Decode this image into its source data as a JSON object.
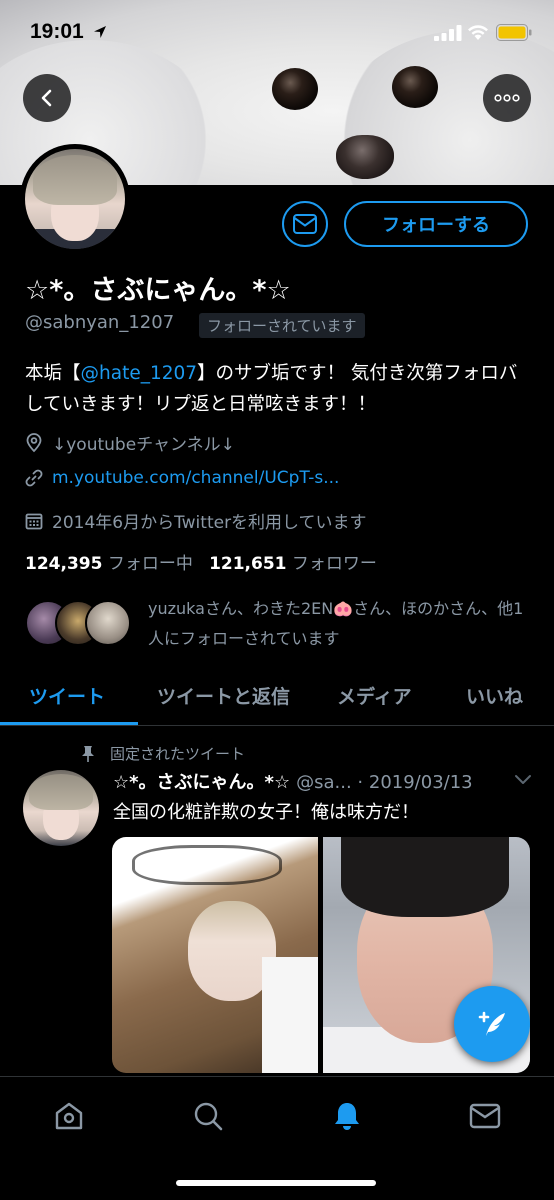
{
  "status_bar": {
    "time": "19:01"
  },
  "profile": {
    "display_name": "☆*。さぶにゃん。*☆",
    "handle": "@sabnyan_1207",
    "follows_you_badge": "フォローされています",
    "follow_button": "フォローする",
    "bio_before": "本垢【",
    "bio_mention": "@hate_1207",
    "bio_after": "】のサブ垢です！ 気付き次第フォロバしていきます！リプ返と日常呟きます！！",
    "location": "↓youtubeチャンネル↓",
    "link": "m.youtube.com/channel/UCpT-s...",
    "joined": "2014年6月からTwitterを利用しています",
    "following_count": "124,395",
    "following_label": "フォロー中",
    "followers_count": "121,651",
    "followers_label": "フォロワー",
    "followed_by_text": "yuzukaさん、わきた2EN🐽さん、ほのかさん、他1人にフォローされています"
  },
  "tabs": [
    {
      "label": "ツイート",
      "active": true
    },
    {
      "label": "ツイートと返信",
      "active": false
    },
    {
      "label": "メディア",
      "active": false
    },
    {
      "label": "いいね",
      "active": false
    }
  ],
  "pinned_tweet": {
    "pinned_label": "固定されたツイート",
    "name": "☆*。さぶにゃん。*☆",
    "handle": "@sa...",
    "date": "· 2019/03/13",
    "text": "全国の化粧詐欺の女子！俺は味方だ！"
  },
  "colors": {
    "accent": "#1d9bf0",
    "background": "#000000",
    "secondary_text": "#8b98a5"
  },
  "icons": {
    "back": "chevron-left-icon",
    "more": "more-horizontal-icon",
    "mail": "envelope-icon",
    "location": "location-pin-icon",
    "link": "link-icon",
    "calendar": "calendar-icon",
    "pin": "pin-icon",
    "compose": "compose-tweet-icon",
    "nav": [
      "home-icon",
      "search-icon",
      "notifications-bell-icon",
      "messages-envelope-icon"
    ]
  }
}
